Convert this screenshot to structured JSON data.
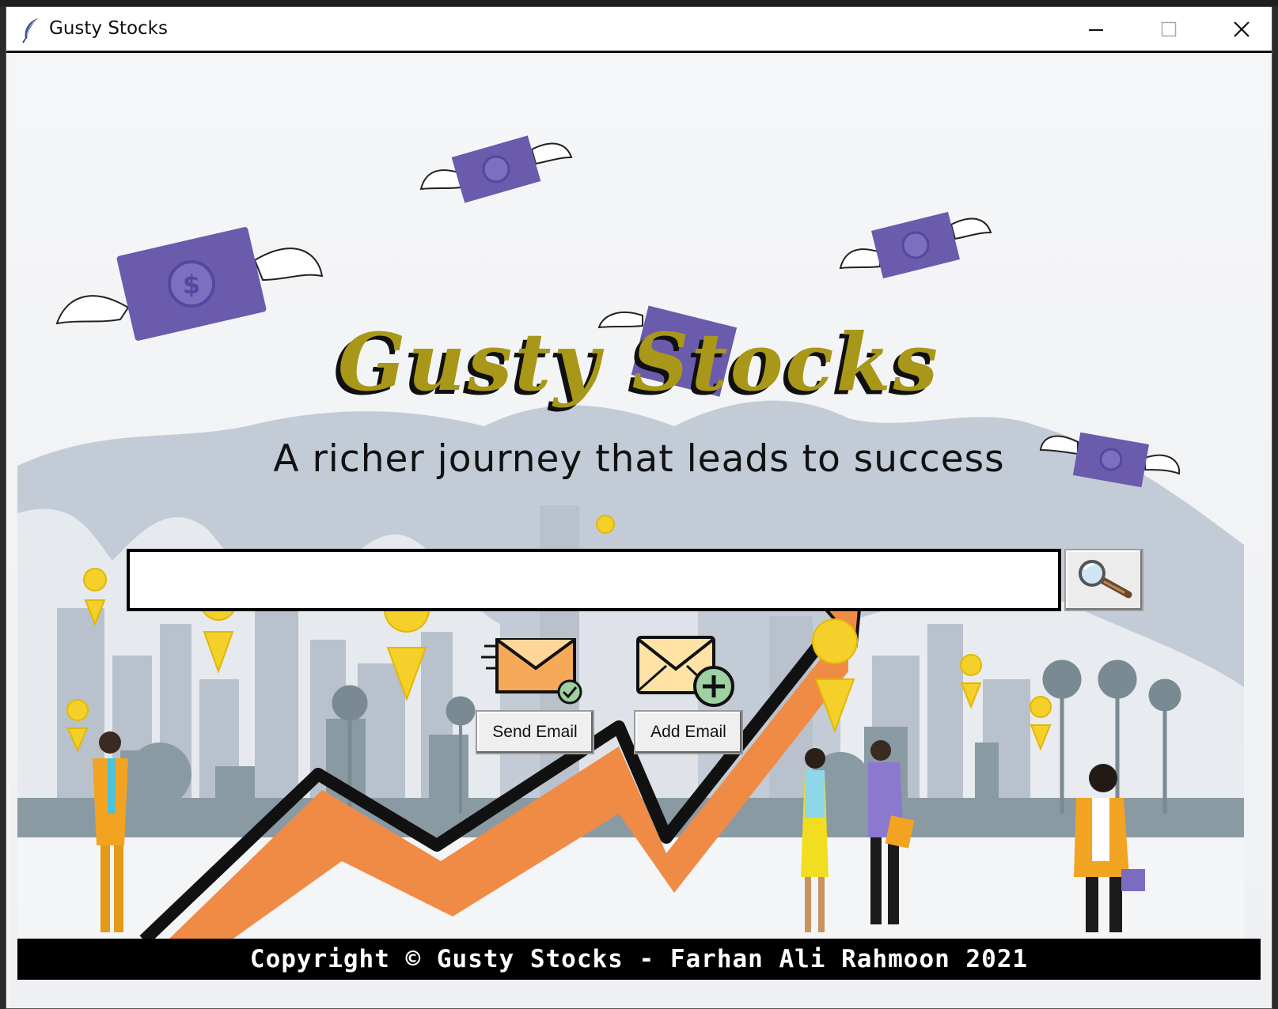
{
  "window": {
    "title": "Gusty Stocks",
    "icon": "feather-icon",
    "controls": [
      "minimize-icon",
      "maximize-icon",
      "close-icon"
    ]
  },
  "header": {
    "logo_text": "Gusty Stocks",
    "tagline": "A richer journey that leads to success"
  },
  "search": {
    "value": "",
    "placeholder": "",
    "button_icon": "magnifier-icon"
  },
  "actions": {
    "send_email_label": "Send Email",
    "add_email_label": "Add Email"
  },
  "footer": {
    "copyright": "Copyright © Gusty Stocks - Farhan Ali Rahmoon 2021"
  },
  "colors": {
    "logo": "#a89718",
    "money": "#6a5bad",
    "arrow": "#f08b45",
    "pin": "#f5d02a",
    "footer_bg": "#000000"
  }
}
